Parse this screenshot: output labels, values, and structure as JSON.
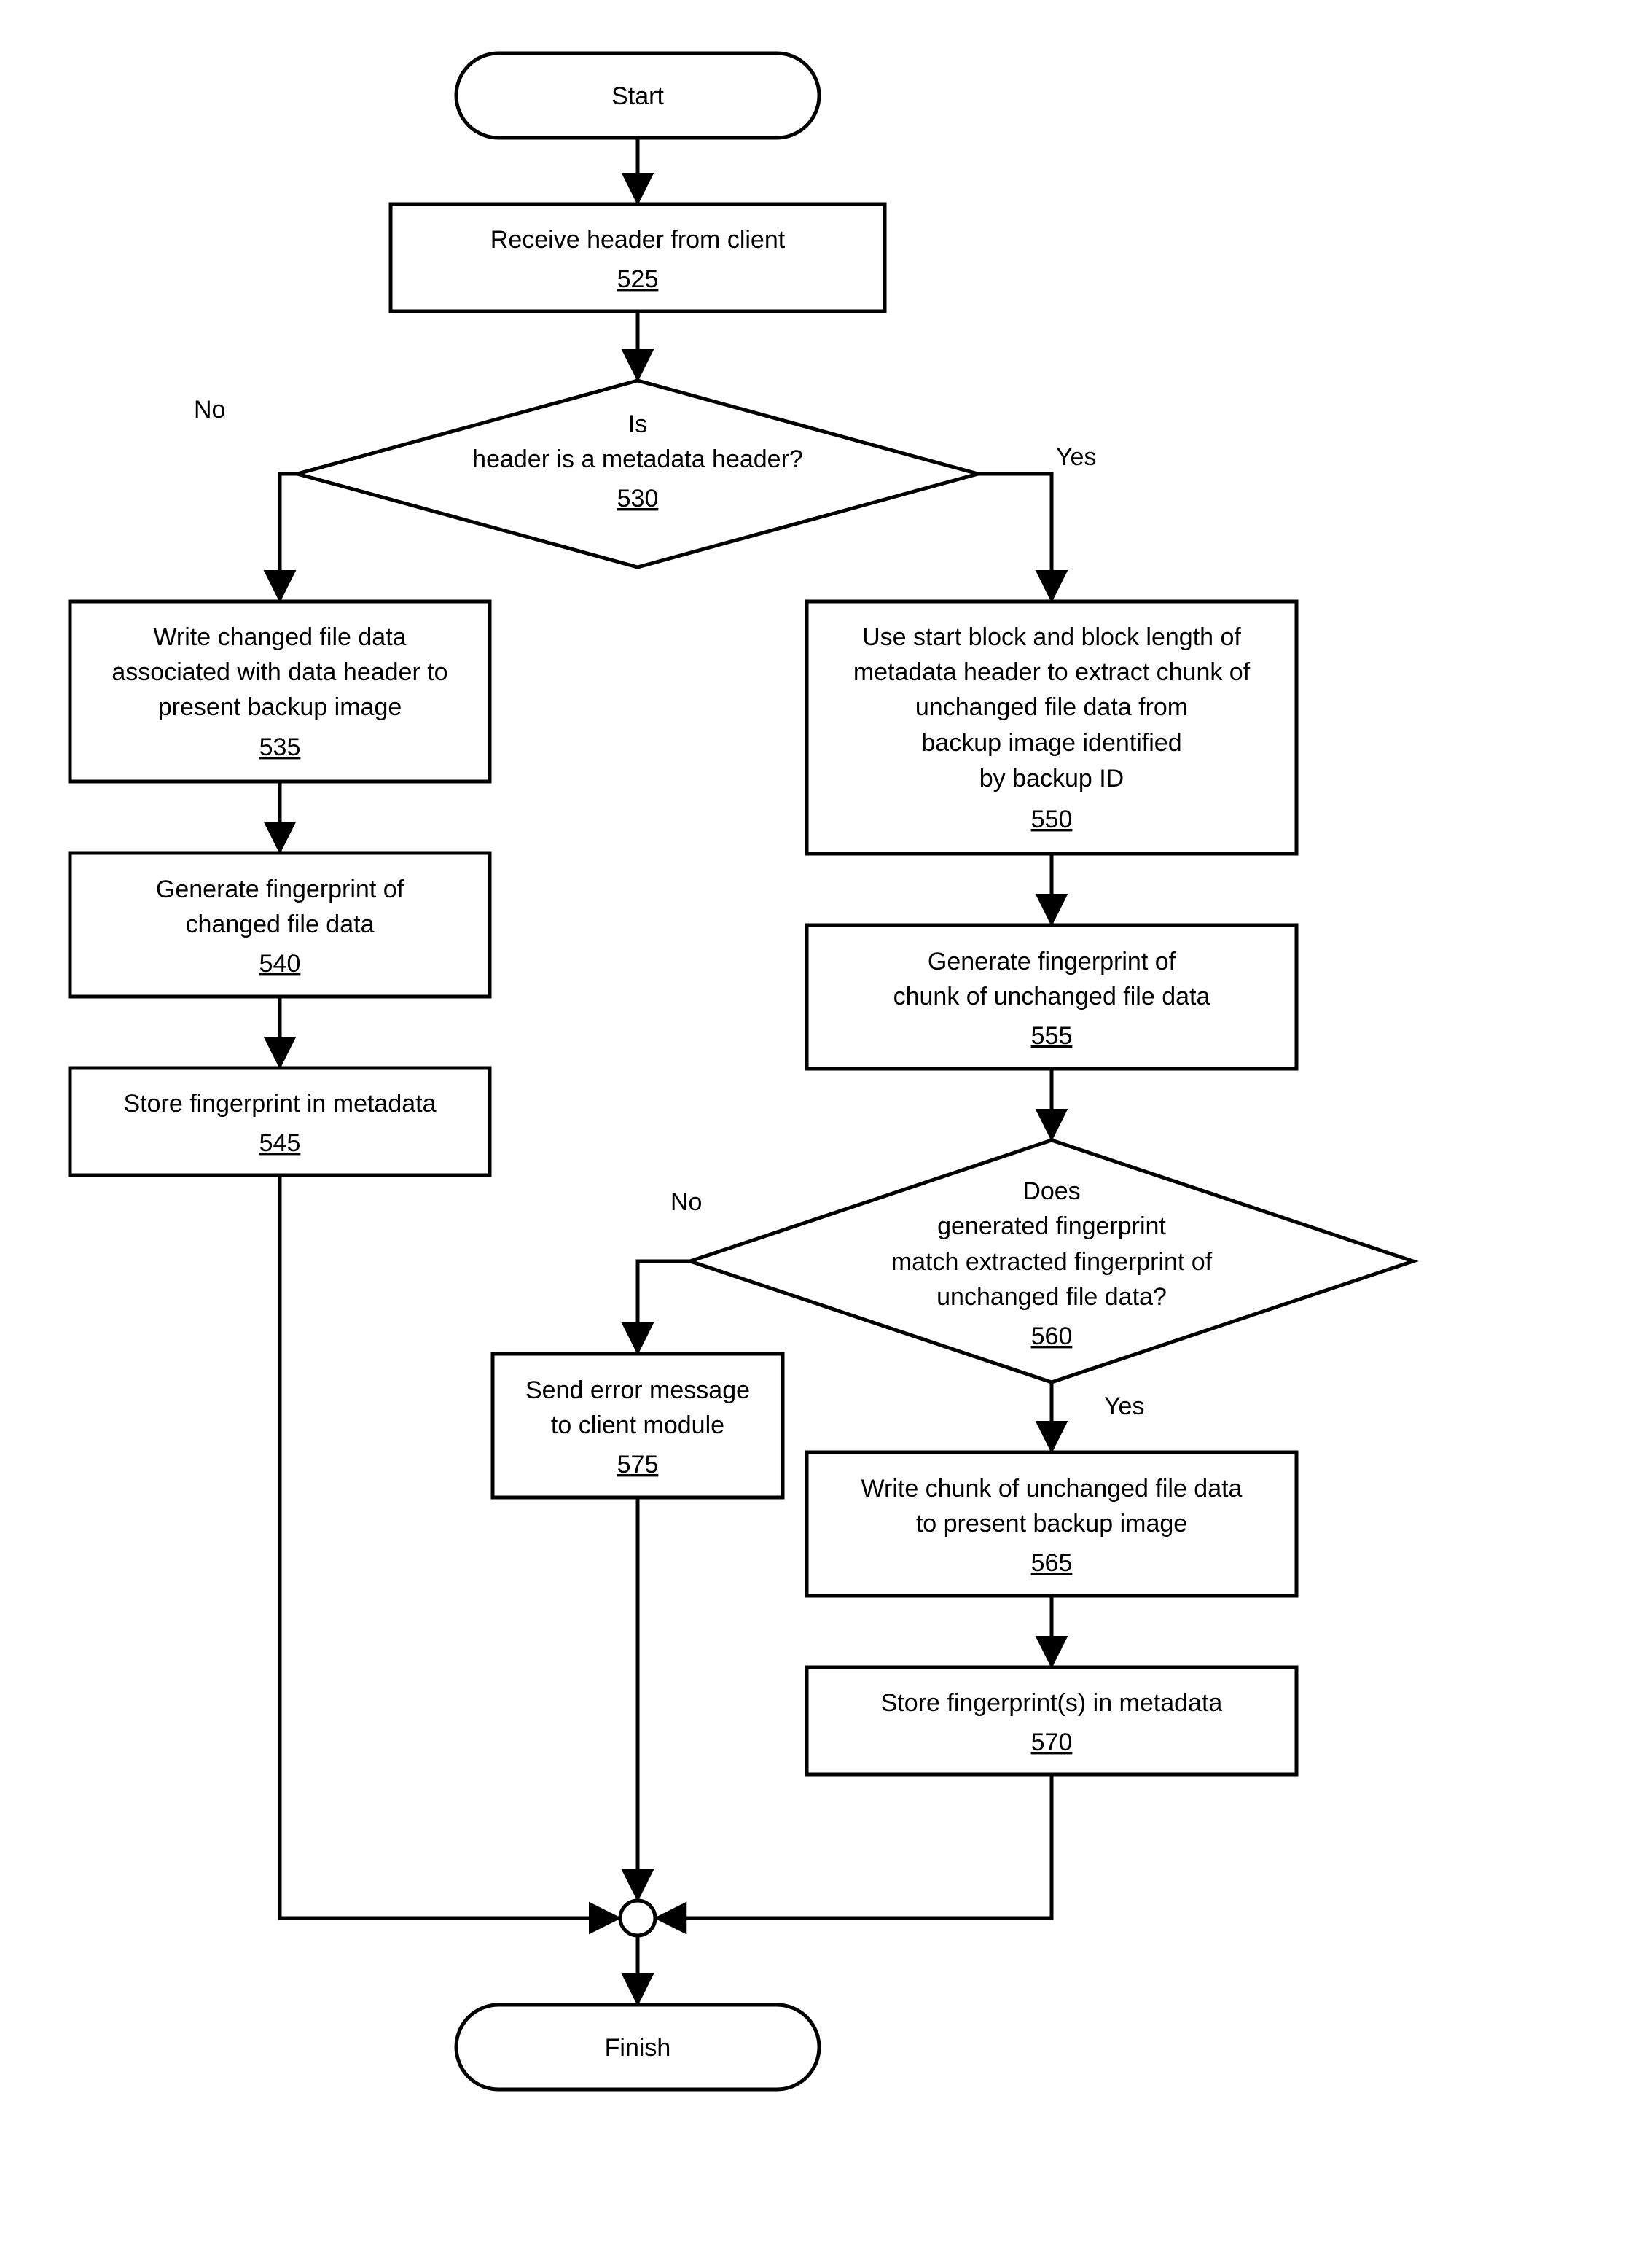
{
  "start": "Start",
  "finish": "Finish",
  "n525": {
    "l1": "Receive header from client",
    "ref": "525"
  },
  "n530": {
    "l1": "Is",
    "l2": "header is a metadata header?",
    "ref": "530",
    "no": "No",
    "yes": "Yes"
  },
  "n535": {
    "l1": "Write changed file data",
    "l2": "associated with data header to",
    "l3": "present backup image",
    "ref": "535"
  },
  "n540": {
    "l1": "Generate fingerprint of",
    "l2": "changed file data",
    "ref": "540"
  },
  "n545": {
    "l1": "Store fingerprint in metadata",
    "ref": "545"
  },
  "n550": {
    "l1": "Use start block and block length of",
    "l2": "metadata header to extract chunk of",
    "l3": "unchanged file data from",
    "l4": "backup image identified",
    "l5": "by backup ID",
    "ref": "550"
  },
  "n555": {
    "l1": "Generate fingerprint of",
    "l2": "chunk of unchanged file data",
    "ref": "555"
  },
  "n560": {
    "l1": "Does",
    "l2": "generated fingerprint",
    "l3": "match extracted fingerprint of",
    "l4": "unchanged file data?",
    "ref": "560",
    "no": "No",
    "yes": "Yes"
  },
  "n565": {
    "l1": "Write chunk of unchanged file data",
    "l2": "to present backup image",
    "ref": "565"
  },
  "n570": {
    "l1": "Store fingerprint(s) in metadata",
    "ref": "570"
  },
  "n575": {
    "l1": "Send error message",
    "l2": "to client module",
    "ref": "575"
  }
}
